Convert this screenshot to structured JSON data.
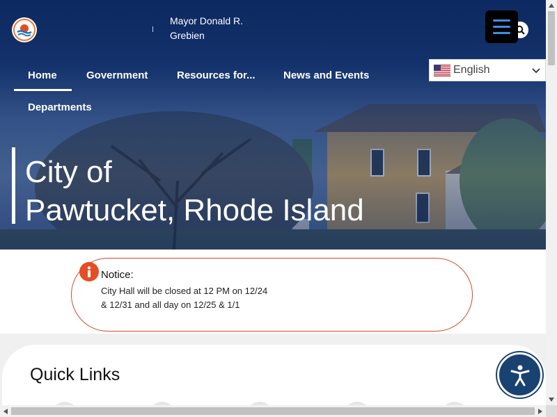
{
  "header": {
    "logo_icon": "city-seal-icon",
    "mayor_text": "Mayor Donald R. Grebien",
    "menu_icon": "hamburger-menu-icon",
    "search_icon": "search-icon"
  },
  "language": {
    "flag_icon": "us-flag-icon",
    "selected": "English",
    "chevron_icon": "chevron-down-icon"
  },
  "nav": {
    "items": [
      {
        "label": "Home",
        "active": true
      },
      {
        "label": "Government"
      },
      {
        "label": "Resources for..."
      },
      {
        "label": "News and Events"
      },
      {
        "label": "Departments"
      }
    ]
  },
  "hero": {
    "title_line1": "City of",
    "title_line2": "Pawtucket, Rhode Island"
  },
  "notice": {
    "icon": "info-icon",
    "title": "Notice:",
    "body": "City Hall will be closed at 12 PM on 12/24 & 12/31 and all day on 12/25 & 1/1"
  },
  "quick_links": {
    "title": "Quick Links"
  },
  "accessibility": {
    "icon": "accessibility-icon"
  },
  "colors": {
    "hero_blue": "#123470",
    "notice_accent": "#e44d26",
    "accessibility_blue": "#1a4270",
    "menu_bar_blue": "#3b8fe6"
  }
}
